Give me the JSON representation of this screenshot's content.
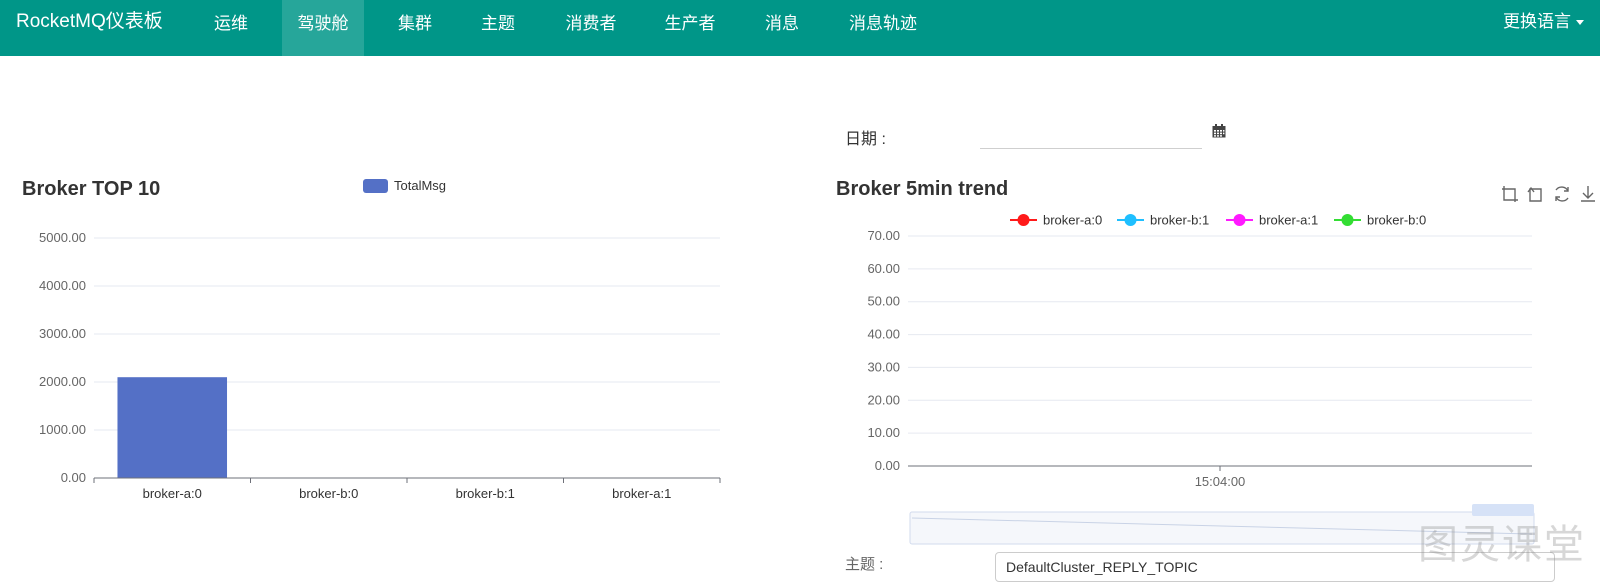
{
  "nav": {
    "brand": "RocketMQ仪表板",
    "items": [
      {
        "label": "运维"
      },
      {
        "label": "驾驶舱"
      },
      {
        "label": "集群"
      },
      {
        "label": "主题"
      },
      {
        "label": "消费者"
      },
      {
        "label": "生产者"
      },
      {
        "label": "消息"
      },
      {
        "label": "消息轨迹"
      }
    ],
    "active": "驾驶舱",
    "language_label": "更换语言"
  },
  "date_filter": {
    "label": "日期 :",
    "value": ""
  },
  "topic_filter": {
    "label": "主题 :",
    "value": "DefaultCluster_REPLY_TOPIC"
  },
  "watermark": "图灵课堂",
  "colors": {
    "navbar": "#009688",
    "nav_active": "#26a69a",
    "bar": "#5470c6"
  },
  "chart_data": [
    {
      "type": "bar",
      "title": "Broker TOP 10",
      "legend": [
        "TotalMsg"
      ],
      "legend_placement": "top",
      "categories": [
        "broker-a:0",
        "broker-b:0",
        "broker-b:1",
        "broker-a:1"
      ],
      "series": [
        {
          "name": "TotalMsg",
          "values": [
            2100,
            0,
            0,
            0
          ]
        }
      ],
      "yticks": [
        "0.00",
        "1000.00",
        "2000.00",
        "3000.00",
        "4000.00",
        "5000.00"
      ],
      "ylim": [
        0,
        5000
      ],
      "grid": true
    },
    {
      "type": "line",
      "title": "Broker 5min trend",
      "legend_placement": "top",
      "x": [
        "15:04:00"
      ],
      "series": [
        {
          "name": "broker-a:0",
          "color": "#ff1a1a",
          "values": []
        },
        {
          "name": "broker-b:1",
          "color": "#1fbfff",
          "values": []
        },
        {
          "name": "broker-a:1",
          "color": "#ff1aff",
          "values": []
        },
        {
          "name": "broker-b:0",
          "color": "#33dd33",
          "values": []
        }
      ],
      "yticks": [
        "0.00",
        "10.00",
        "20.00",
        "30.00",
        "40.00",
        "50.00",
        "60.00",
        "70.00"
      ],
      "ylim": [
        0,
        70
      ],
      "grid": true,
      "toolbox": [
        "zoom-icon",
        "zoom-reset-icon",
        "restore-icon",
        "download-icon"
      ]
    }
  ]
}
